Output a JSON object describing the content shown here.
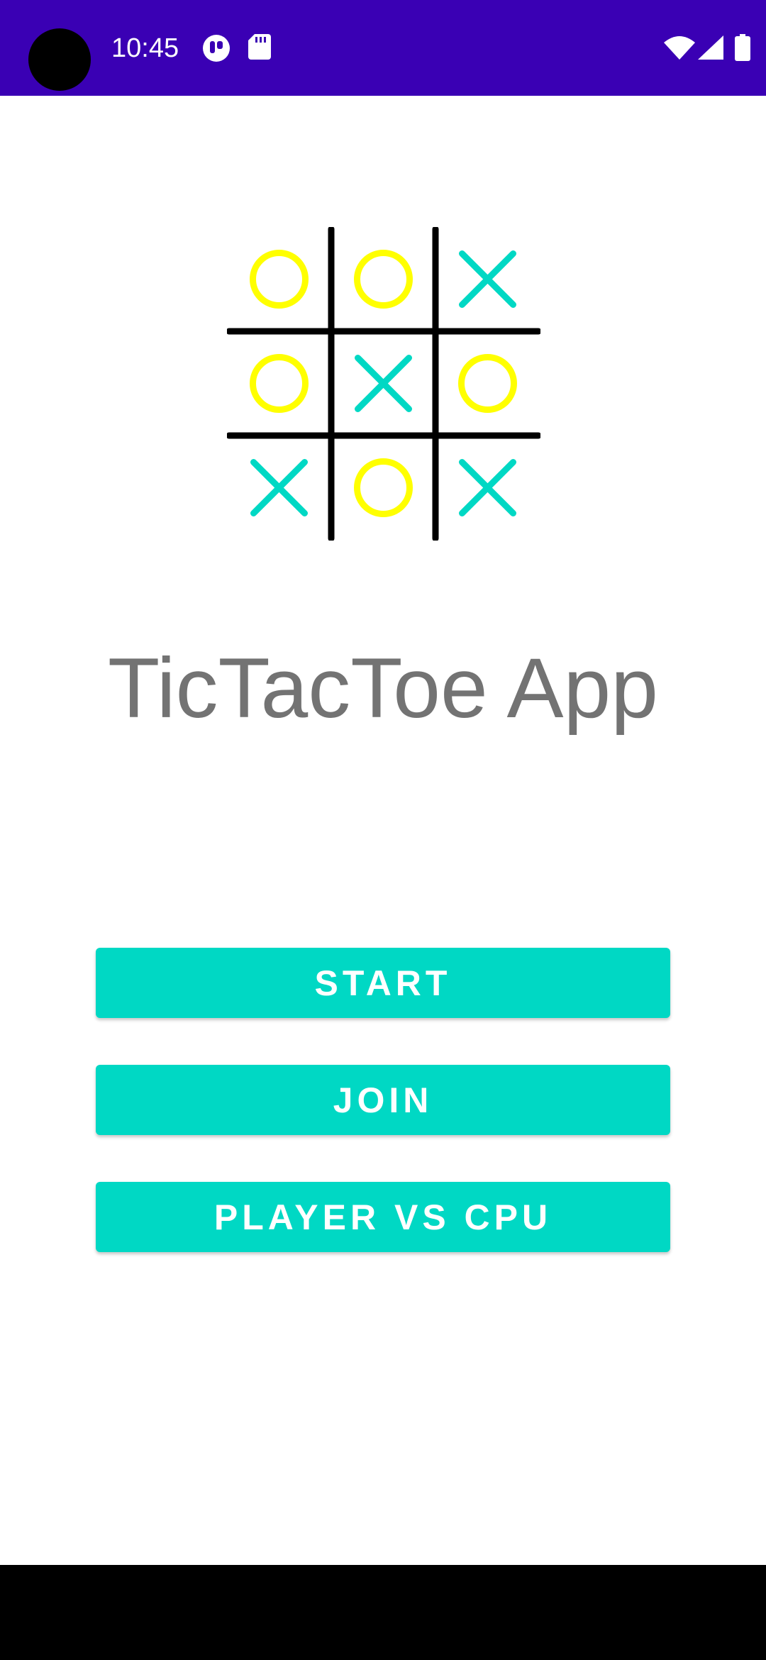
{
  "status_bar": {
    "time": "10:45",
    "background": "#3a00b4",
    "icons_left": [
      "app-notification-icon",
      "sd-card-icon"
    ],
    "icons_right": [
      "wifi-icon",
      "cellular-signal-icon",
      "battery-icon"
    ]
  },
  "logo": {
    "grid": [
      [
        "O",
        "O",
        "X"
      ],
      [
        "O",
        "X",
        "O"
      ],
      [
        "X",
        "O",
        "X"
      ]
    ],
    "o_color": "#ffff00",
    "x_color": "#00d8c4",
    "line_color": "#000000"
  },
  "app_title": "TicTacToe App",
  "buttons": {
    "start_label": "START",
    "join_label": "JOIN",
    "cpu_label": "PLAYER VS CPU",
    "color": "#00d8c4"
  }
}
